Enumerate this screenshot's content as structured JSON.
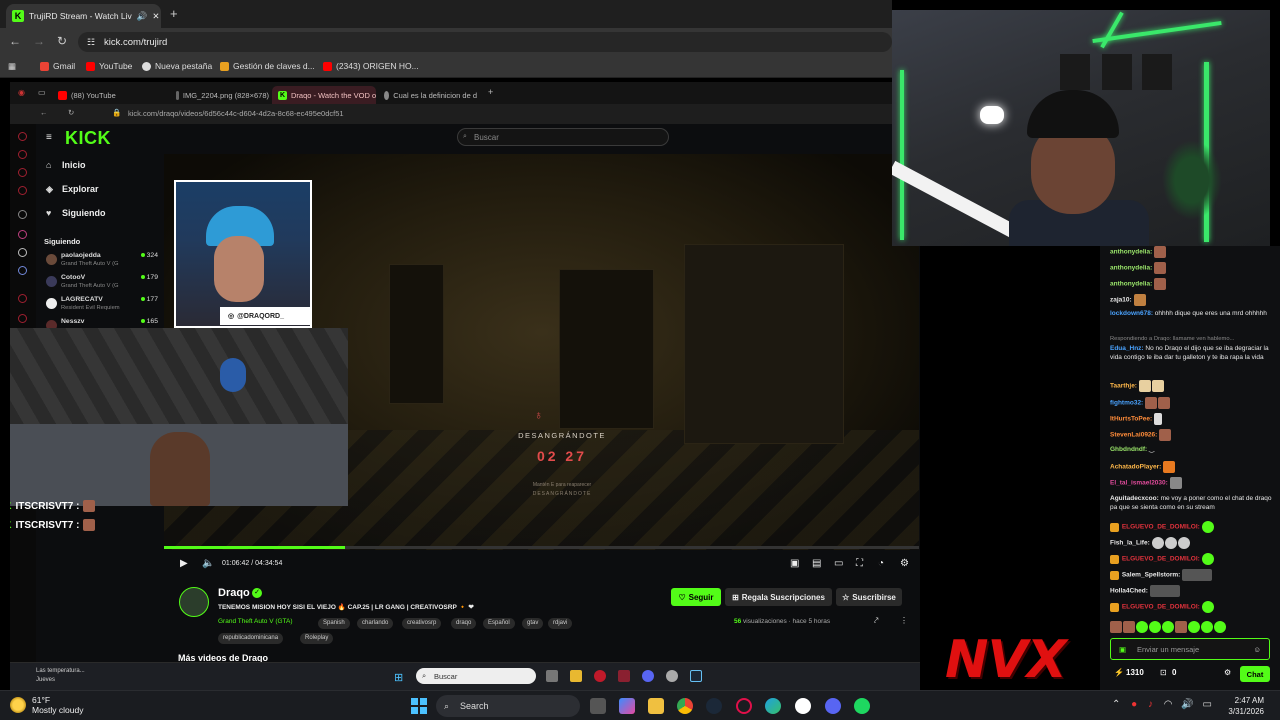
{
  "outer_browser": {
    "tab_title": "TrujiRD Stream - Watch Liv",
    "url": "kick.com/trujird",
    "bookmarks": [
      "Gmail",
      "YouTube",
      "Nueva pestaña",
      "Gestión de claves d...",
      "(2343) ORIGEN HO..."
    ]
  },
  "inner_browser": {
    "tabs": [
      "(88) YouTube",
      "IMG_2204.png (828×678)",
      "Draqo - Watch the VOD o",
      "Cual es la definicion de d"
    ],
    "url": "kick.com/draqo/videos/6d56c44c-d604-4d2a-8c68-ec495e0dcf51",
    "search_placeholder": "Buscar",
    "logo": "KICK",
    "nav": [
      "Inicio",
      "Explorar",
      "Siguiendo"
    ],
    "following_title": "Siguiendo",
    "following": [
      {
        "name": "paolaojedda",
        "game": "Grand Theft Auto V (G",
        "viewers": "324"
      },
      {
        "name": "CotooV",
        "game": "Grand Theft Auto V (G",
        "viewers": "179"
      },
      {
        "name": "LAGRECATV",
        "game": "Resident Evil Requiem",
        "viewers": "177"
      },
      {
        "name": "Nesszv",
        "game": "",
        "viewers": "165"
      }
    ],
    "game_caption": "DESANGRÁNDOTE",
    "game_timer": "02 27",
    "game_sub": "Mantén E para reaparecer",
    "game_sub2": "DESANGRÁNDOTE",
    "cam_handle": "@DRAQORD_",
    "chat_overlay": [
      "ITSCRISVT7 :",
      "ITSCRISVT7 :"
    ],
    "time": "01:06:42 / 04:34:54",
    "progress": 0.24,
    "channel": {
      "name": "Draqo",
      "title": "TENEMOS MISION HOY SISI EL VIEJO 🔥 CAP.25 | LR GANG | CREATIVOSRP 🔸 ❤",
      "category": "Grand Theft Auto V (GTA)",
      "tags": [
        "Spanish",
        "charlando",
        "creativosrp",
        "draqo",
        "Español",
        "gtav",
        "rdjavi",
        "republicadominicana",
        "Roleplay"
      ],
      "follow": "Seguir",
      "gift": "Regala Suscripciones",
      "subscribe": "Suscribirse",
      "views_count": "56",
      "views_label": "visualizaciones",
      "time_ago": "hace 5 horas"
    },
    "more_videos": "Más videos de Draqo",
    "taskbar": {
      "weather": "Las temperatura...",
      "weather_sub": "Jueves",
      "search": "Buscar"
    }
  },
  "chat": {
    "messages": [
      {
        "user": "anthonydelia:",
        "text": "",
        "color": "#9be76b"
      },
      {
        "user": "anthonydelia:",
        "text": "",
        "color": "#9be76b"
      },
      {
        "user": "anthonydelia:",
        "text": "",
        "color": "#9be76b"
      },
      {
        "user": "zaja10:",
        "text": "",
        "color": "#e8e8e8"
      },
      {
        "user": "lockdown678:",
        "text": "ohhhh dique que eres una mrd ohhhhh",
        "color": "#4aa3ff"
      },
      {
        "user": "Respondiendo a Draqo: llamame ven hablemo...",
        "text": "",
        "color": "#888888"
      },
      {
        "user": "Edua_Hnz:",
        "text": "No no Draqo el dijo que se iba degraciar la vida contigo te iba dar tu galleton y te iba rapa la vida",
        "color": "#4aa3ff"
      },
      {
        "user": "Taarthje:",
        "text": "",
        "color": "#ffb84a"
      },
      {
        "user": "fightmo32:",
        "text": "",
        "color": "#4aa3ff"
      },
      {
        "user": "ItHurtsToPee:",
        "text": "",
        "color": "#ff8c3a"
      },
      {
        "user": "StevenLai0926:",
        "text": "",
        "color": "#ff8c3a"
      },
      {
        "user": "Ghbdndndf:",
        "text": "",
        "color": "#9be76b"
      },
      {
        "user": "AchatadoPlayer:",
        "text": "",
        "color": "#ffb84a"
      },
      {
        "user": "El_tal_ismael2030:",
        "text": "",
        "color": "#e24b9c"
      },
      {
        "user": "Aguitadecxcoo:",
        "text": "me voy a poner como el chat de draqo pa que se sienta como en su stream",
        "color": "#e8e8e8"
      },
      {
        "user": "ELGUEVO_DE_DOMILOI:",
        "text": "",
        "color": "#e0323c"
      },
      {
        "user": "Fish_la_Life:",
        "text": "",
        "color": "#e8e8e8"
      },
      {
        "user": "ELGUEVO_DE_DOMILOI:",
        "text": "",
        "color": "#e0323c"
      },
      {
        "user": "Salem_Spellstorm:",
        "text": "",
        "color": "#e8e8e8"
      },
      {
        "user": "Holla4Ched:",
        "text": "",
        "color": "#e8e8e8"
      },
      {
        "user": "ELGUEVO_DE_DOMILOI:",
        "text": "",
        "color": "#e0323c"
      }
    ],
    "input_placeholder": "Enviar un mensaje",
    "points": "1310",
    "gifts": "0",
    "send": "Chat"
  },
  "overlay_brand": "NVX",
  "taskbar": {
    "temp": "61°F",
    "condition": "Mostly cloudy",
    "search": "Search",
    "time": "2:47 AM",
    "date": "3/31/2026"
  },
  "accent": "#53fc18"
}
